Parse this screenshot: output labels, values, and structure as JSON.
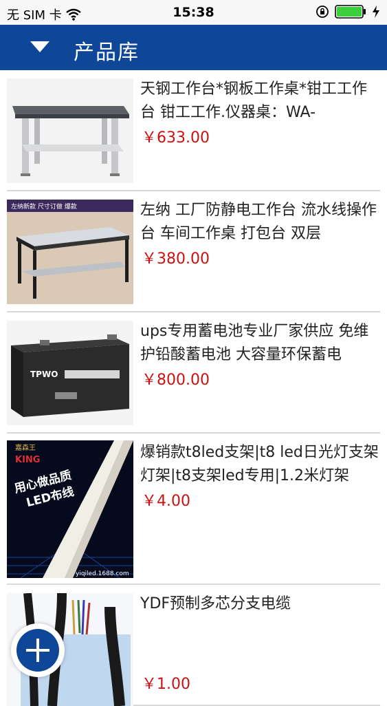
{
  "status_bar": {
    "carrier": "无 SIM 卡",
    "time": "15:38",
    "icons": [
      "wifi-icon",
      "rotation-lock-icon",
      "battery-icon",
      "charging-icon"
    ],
    "battery_color": "#3ccf3c"
  },
  "header": {
    "title": "产品库",
    "menu_icon": "caret-down-icon",
    "bg_color": "#0e4698"
  },
  "products": [
    {
      "title": "天钢工作台*钢板工作桌*钳工工作台 钳工工作.仪器桌：WA-",
      "price": "￥633.00"
    },
    {
      "title": "左纳 工厂防静电工作台 流水线操作台 车间工作桌 打包台 双层",
      "price": "￥380.00",
      "image_text": "左纳新款 尺寸订做 爆款"
    },
    {
      "title": "ups专用蓄电池专业厂家供应 免维护铅酸蓄电池 大容量环保蓄电",
      "price": "￥800.00",
      "image_text": "TPWO"
    },
    {
      "title": "爆销款t8led支架|t8 led日光灯支架灯架|t8支架led专用|1.2米灯架",
      "price": "￥4.00",
      "image_text": {
        "brand": "嘉森王",
        "brand_en": "KING",
        "line1": "用心做品质",
        "line2": "LED布线",
        "site": "yiqiled.1688.com"
      }
    },
    {
      "title": "YDF预制多芯分支电缆",
      "price": "￥1.00"
    }
  ],
  "fab": {
    "icon": "plus-icon",
    "color": "#0e4698"
  },
  "price_color": "#cc1111"
}
